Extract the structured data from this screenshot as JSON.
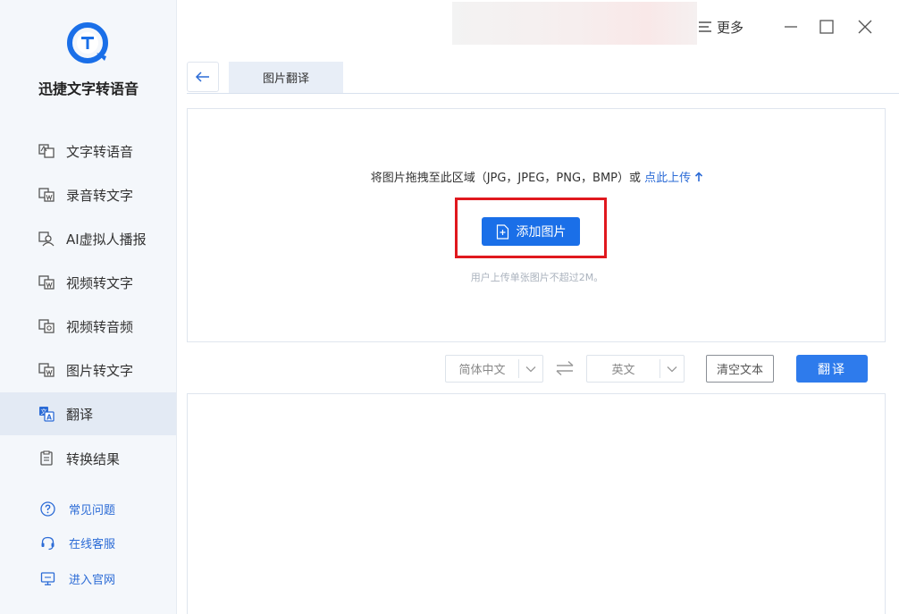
{
  "app": {
    "name": "迅捷文字转语音",
    "brand_color": "#1a6fe8"
  },
  "sidebar": {
    "items": [
      {
        "label": "文字转语音",
        "icon": "text-to-speech-icon"
      },
      {
        "label": "录音转文字",
        "icon": "recording-to-text-icon"
      },
      {
        "label": "AI虚拟人播报",
        "icon": "ai-avatar-icon"
      },
      {
        "label": "视频转文字",
        "icon": "video-to-text-icon"
      },
      {
        "label": "视频转音频",
        "icon": "video-to-audio-icon"
      },
      {
        "label": "图片转文字",
        "icon": "image-to-text-icon"
      },
      {
        "label": "翻译",
        "icon": "translate-icon",
        "active": true
      },
      {
        "label": "转换结果",
        "icon": "results-icon"
      }
    ],
    "help": [
      {
        "label": "常见问题",
        "icon": "question-icon"
      },
      {
        "label": "在线客服",
        "icon": "headset-icon"
      },
      {
        "label": "进入官网",
        "icon": "monitor-icon"
      }
    ]
  },
  "topbar": {
    "more_label": "更多"
  },
  "tabs": [
    {
      "label": "图片翻译",
      "active": true
    }
  ],
  "upload": {
    "drop_text": "将图片拖拽至此区域（JPG，JPEG，PNG，BMP）或",
    "upload_link": "点此上传",
    "add_button": "添加图片",
    "hint": "用户上传单张图片不超过2M。"
  },
  "controls": {
    "source_lang": "简体中文",
    "target_lang": "英文",
    "clear_label": "清空文本",
    "translate_label": "翻译"
  }
}
